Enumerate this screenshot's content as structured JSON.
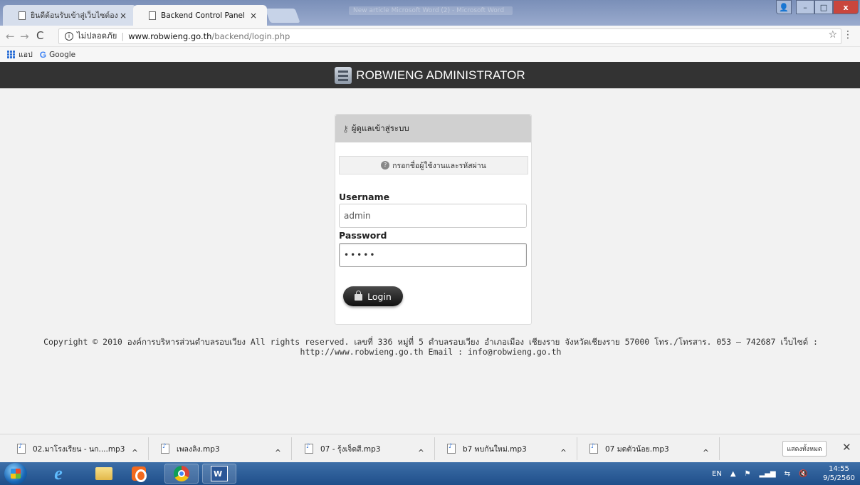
{
  "window": {
    "inactive_tab": "ยินดีต้อนรับเข้าสู่เว็บไซต์องค์",
    "active_tab": "Backend Control Panel",
    "background_title": "New article Microsoft Word (2) - Microsoft Word",
    "tab_close": "×",
    "controls": {
      "user": "👤",
      "minimize": "–",
      "maximize": "□",
      "close": "x"
    }
  },
  "toolbar": {
    "back": "←",
    "forward": "→",
    "reload": "C",
    "info": "i",
    "security_label": "ไม่ปลอดภัย",
    "url_host": "www.robwieng.go.th",
    "url_path": "/backend/login.php",
    "star": "☆",
    "menu": "⋮"
  },
  "bookmarks": [
    {
      "label": "แอป",
      "icon": "apps-grid-icon"
    },
    {
      "label": "Google",
      "icon": "google-icon"
    }
  ],
  "site_header": {
    "title": "ROBWIENG ADMINISTRATOR",
    "icon": "server-icon"
  },
  "login": {
    "panel_title": "ผู้ดูแลเข้าสู่ระบบ",
    "notice": "กรอกชื่อผู้ใช้งานและรหัสผ่าน",
    "username_label": "Username",
    "username_value": "admin",
    "password_label": "Password",
    "password_value": "•••••",
    "button": "Login"
  },
  "footer": {
    "text": "Copyright © 2010 องค์การบริหารส่วนตำบลรอบเวียง All rights reserved. เลขที่ 336 หมู่ที่ 5 ตำบลรอบเวียง อำเภอเมือง เชียงราย จังหวัดเชียงราย 57000 โทร./โทรสาร. 053 – 742687 เว็บไซต์ : http://www.robwieng.go.th Email : info@robwieng.go.th"
  },
  "downloads": {
    "items": [
      "02.มาโรงเรียน - นก....mp3",
      "เพลงลิง.mp3",
      "07 - รุ้งเจ็ดสี.mp3",
      "b7 พบกันใหม่.mp3",
      "07 มดตัวน้อย.mp3"
    ],
    "caret": "^",
    "show_all": "แสดงทั้งหมด",
    "close": "✕"
  },
  "taskbar": {
    "apps": [
      "internet-explorer",
      "file-explorer",
      "media-player",
      "chrome",
      "word"
    ],
    "tray": {
      "lang": "EN",
      "up": "▲",
      "flag": "⚑",
      "signal": "▂▄▆",
      "network": "⇆",
      "volume": "🔇"
    },
    "time": "14:55",
    "date": "9/5/2560"
  }
}
